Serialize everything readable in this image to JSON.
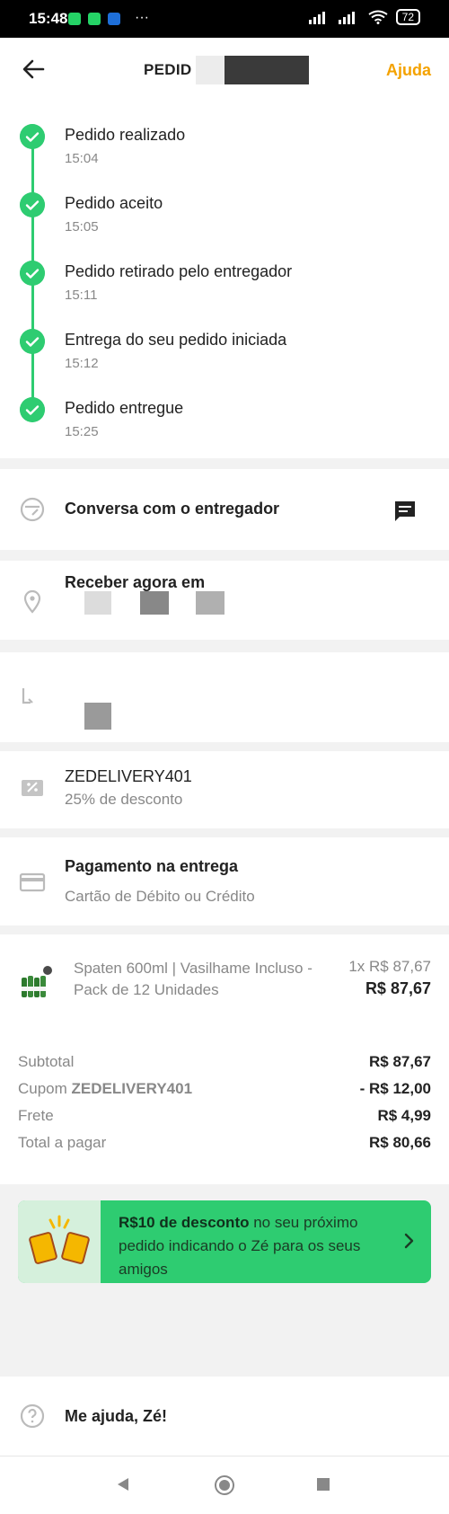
{
  "status_bar": {
    "time": "15:48",
    "battery": "72"
  },
  "header": {
    "title": "PEDID",
    "help_label": "Ajuda"
  },
  "timeline": [
    {
      "title": "Pedido realizado",
      "time": "15:04"
    },
    {
      "title": "Pedido aceito",
      "time": "15:05"
    },
    {
      "title": "Pedido retirado pelo entregador",
      "time": "15:11"
    },
    {
      "title": "Entrega do seu pedido iniciada",
      "time": "15:12"
    },
    {
      "title": "Pedido entregue",
      "time": "15:25"
    }
  ],
  "chat": {
    "label": "Conversa com o entregador"
  },
  "address": {
    "label": "Receber agora em"
  },
  "coupon": {
    "code": "ZEDELIVERY401",
    "discount": "25% de desconto"
  },
  "payment": {
    "title": "Pagamento na entrega",
    "method": "Cartão de Débito ou Crédito"
  },
  "product": {
    "name": "Spaten 600ml | Vasilhame Incluso - Pack de 12 Unidades",
    "qty_price": "1x R$ 87,67",
    "total": "R$ 87,67"
  },
  "summary": {
    "subtotal_label": "Subtotal",
    "subtotal_value": "R$ 87,67",
    "coupon_label": "Cupom",
    "coupon_code": "ZEDELIVERY401",
    "coupon_value": "- R$ 12,00",
    "shipping_label": "Frete",
    "shipping_value": "R$ 4,99",
    "total_label": "Total a pagar",
    "total_value": "R$ 80,66"
  },
  "promo": {
    "bold": "R$10 de desconto",
    "text": " no seu próximo pedido indicando o Zé para os seus amigos"
  },
  "help_footer": {
    "label": "Me ajuda, Zé!"
  },
  "colors": {
    "accent": "#f4a200",
    "success": "#2ecc71"
  }
}
